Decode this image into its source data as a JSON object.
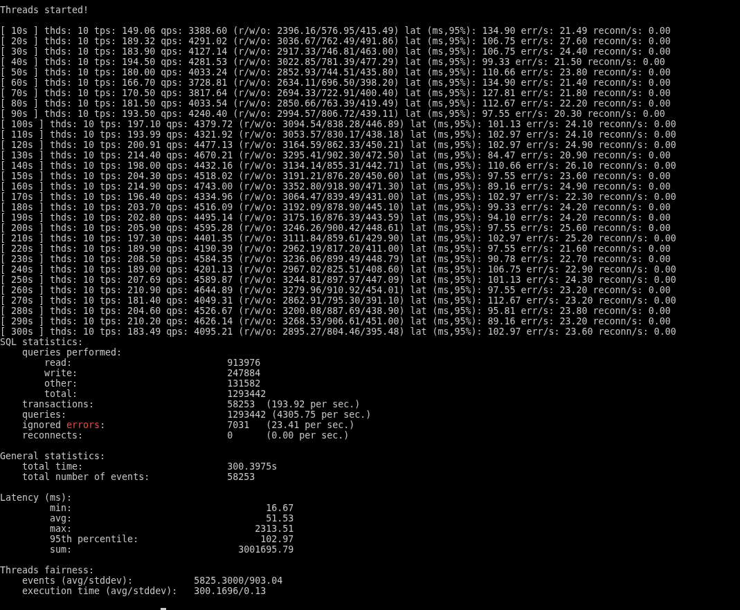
{
  "terminal": {
    "blocks": [
      {
        "lines": [
          "Threads started!"
        ]
      },
      {
        "lines": [
          "[ 10s ] thds: 10 tps: 149.06 qps: 3388.60 (r/w/o: 2396.16/576.95/415.49) lat (ms,95%): 134.90 err/s: 21.49 reconn/s: 0.00",
          "[ 20s ] thds: 10 tps: 189.32 qps: 4291.02 (r/w/o: 3036.67/762.49/491.86) lat (ms,95%): 106.75 err/s: 27.60 reconn/s: 0.00",
          "[ 30s ] thds: 10 tps: 183.90 qps: 4127.14 (r/w/o: 2917.33/746.81/463.00) lat (ms,95%): 106.75 err/s: 24.40 reconn/s: 0.00",
          "[ 40s ] thds: 10 tps: 194.50 qps: 4281.53 (r/w/o: 3022.85/781.39/477.29) lat (ms,95%): 99.33 err/s: 21.50 reconn/s: 0.00",
          "[ 50s ] thds: 10 tps: 180.00 qps: 4033.24 (r/w/o: 2852.93/744.51/435.80) lat (ms,95%): 110.66 err/s: 23.80 reconn/s: 0.00",
          "[ 60s ] thds: 10 tps: 166.70 qps: 3728.81 (r/w/o: 2634.11/696.50/398.20) lat (ms,95%): 134.90 err/s: 21.40 reconn/s: 0.00",
          "[ 70s ] thds: 10 tps: 170.50 qps: 3817.64 (r/w/o: 2694.33/722.91/400.40) lat (ms,95%): 127.81 err/s: 21.80 reconn/s: 0.00",
          "[ 80s ] thds: 10 tps: 181.50 qps: 4033.54 (r/w/o: 2850.66/763.39/419.49) lat (ms,95%): 112.67 err/s: 22.20 reconn/s: 0.00",
          "[ 90s ] thds: 10 tps: 193.50 qps: 4240.40 (r/w/o: 2994.57/806.72/439.11) lat (ms,95%): 97.55 err/s: 20.30 reconn/s: 0.00",
          "[ 100s ] thds: 10 tps: 197.10 qps: 4379.72 (r/w/o: 3094.54/838.28/446.89) lat (ms,95%): 101.13 err/s: 24.10 reconn/s: 0.00",
          "[ 110s ] thds: 10 tps: 193.99 qps: 4321.92 (r/w/o: 3053.57/830.17/438.18) lat (ms,95%): 102.97 err/s: 24.10 reconn/s: 0.00",
          "[ 120s ] thds: 10 tps: 200.91 qps: 4477.13 (r/w/o: 3164.59/862.33/450.21) lat (ms,95%): 102.97 err/s: 24.90 reconn/s: 0.00",
          "[ 130s ] thds: 10 tps: 214.40 qps: 4670.21 (r/w/o: 3295.41/902.30/472.50) lat (ms,95%): 84.47 err/s: 20.90 reconn/s: 0.00",
          "[ 140s ] thds: 10 tps: 198.00 qps: 4432.16 (r/w/o: 3134.14/855.31/442.71) lat (ms,95%): 110.66 err/s: 26.10 reconn/s: 0.00",
          "[ 150s ] thds: 10 tps: 204.30 qps: 4518.02 (r/w/o: 3191.21/876.20/450.60) lat (ms,95%): 97.55 err/s: 23.60 reconn/s: 0.00",
          "[ 160s ] thds: 10 tps: 214.90 qps: 4743.00 (r/w/o: 3352.80/918.90/471.30) lat (ms,95%): 89.16 err/s: 24.90 reconn/s: 0.00",
          "[ 170s ] thds: 10 tps: 196.40 qps: 4334.96 (r/w/o: 3064.47/839.49/431.00) lat (ms,95%): 102.97 err/s: 22.30 reconn/s: 0.00",
          "[ 180s ] thds: 10 tps: 203.70 qps: 4516.09 (r/w/o: 3192.09/878.90/445.10) lat (ms,95%): 99.33 err/s: 24.20 reconn/s: 0.00",
          "[ 190s ] thds: 10 tps: 202.80 qps: 4495.14 (r/w/o: 3175.16/876.39/443.59) lat (ms,95%): 94.10 err/s: 24.20 reconn/s: 0.00",
          "[ 200s ] thds: 10 tps: 205.90 qps: 4595.28 (r/w/o: 3246.26/900.42/448.61) lat (ms,95%): 97.55 err/s: 25.60 reconn/s: 0.00",
          "[ 210s ] thds: 10 tps: 197.30 qps: 4401.35 (r/w/o: 3111.84/859.61/429.90) lat (ms,95%): 102.97 err/s: 25.20 reconn/s: 0.00",
          "[ 220s ] thds: 10 tps: 189.90 qps: 4190.39 (r/w/o: 2962.19/817.20/411.00) lat (ms,95%): 97.55 err/s: 21.60 reconn/s: 0.00",
          "[ 230s ] thds: 10 tps: 208.50 qps: 4584.35 (r/w/o: 3236.06/899.49/448.79) lat (ms,95%): 90.78 err/s: 22.70 reconn/s: 0.00",
          "[ 240s ] thds: 10 tps: 189.00 qps: 4201.13 (r/w/o: 2967.02/825.51/408.60) lat (ms,95%): 106.75 err/s: 22.90 reconn/s: 0.00",
          "[ 250s ] thds: 10 tps: 207.69 qps: 4589.87 (r/w/o: 3244.81/897.97/447.09) lat (ms,95%): 101.13 err/s: 24.30 reconn/s: 0.00",
          "[ 260s ] thds: 10 tps: 210.90 qps: 4644.89 (r/w/o: 3279.96/910.92/454.01) lat (ms,95%): 97.55 err/s: 23.20 reconn/s: 0.00",
          "[ 270s ] thds: 10 tps: 181.40 qps: 4049.31 (r/w/o: 2862.91/795.30/391.10) lat (ms,95%): 112.67 err/s: 23.20 reconn/s: 0.00",
          "[ 280s ] thds: 10 tps: 204.60 qps: 4526.67 (r/w/o: 3200.08/887.69/438.90) lat (ms,95%): 95.81 err/s: 23.80 reconn/s: 0.00",
          "[ 290s ] thds: 10 tps: 210.20 qps: 4626.14 (r/w/o: 3268.53/906.61/451.00) lat (ms,95%): 89.16 err/s: 23.20 reconn/s: 0.00",
          "[ 300s ] thds: 10 tps: 183.49 qps: 4095.21 (r/w/o: 2895.27/804.46/395.48) lat (ms,95%): 102.97 err/s: 23.60 reconn/s: 0.00",
          "SQL statistics:",
          "    queries performed:",
          "        read:                            913976",
          "        write:                           247884",
          "        other:                           131582",
          "        total:                           1293442",
          "    transactions:                        58253  (193.92 per sec.)",
          "    queries:                             1293442 (4305.75 per sec.)",
          {
            "segments": [
              {
                "text": "    ignored ",
                "kind": "normal"
              },
              {
                "text": "errors",
                "kind": "error"
              },
              {
                "text": ":                      7031   (23.41 per sec.)",
                "kind": "normal"
              }
            ]
          },
          "    reconnects:                          0      (0.00 per sec.)"
        ]
      },
      {
        "lines": [
          "General statistics:",
          "    total time:                          300.3975s",
          "    total number of events:              58253"
        ]
      },
      {
        "lines": [
          "Latency (ms):",
          "         min:                                   16.67",
          "         avg:                                   51.53",
          "         max:                                 2313.51",
          "         95th percentile:                      102.97",
          "         sum:                              3001695.79"
        ]
      },
      {
        "lines": [
          "Threads fairness:",
          "    events (avg/stddev):           5825.3000/903.04",
          "    execution time (avg/stddev):   300.1696/0.13"
        ]
      }
    ],
    "cursor": {
      "visible": true
    }
  }
}
